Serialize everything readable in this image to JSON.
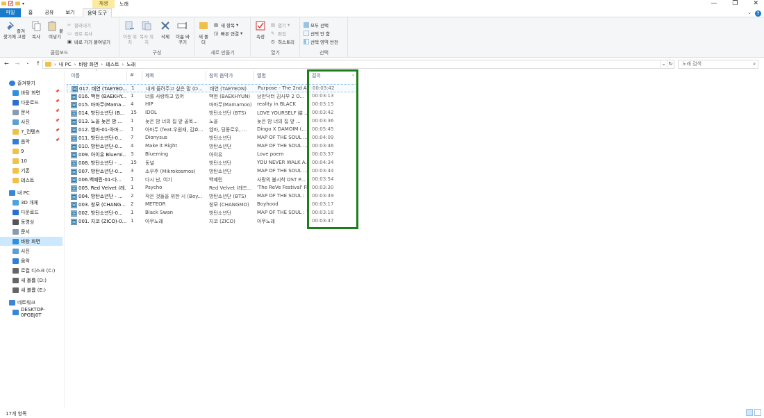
{
  "window": {
    "title": "노래",
    "context_tab_group": "재생",
    "controls": [
      "—",
      "❐",
      "✕"
    ]
  },
  "ribbon_tabs": [
    "파일",
    "홈",
    "공유",
    "보기",
    "음악 도구"
  ],
  "ribbon": {
    "clipboard": {
      "label": "클립보드",
      "pin": "즐겨찾기에 고정",
      "copy": "복사",
      "paste": "붙여넣기",
      "cut": "잘라내기",
      "copy_path": "경로 복사",
      "paste_shortcut": "바로 가기 붙여넣기"
    },
    "organize": {
      "label": "구성",
      "move_to": "이동 위치",
      "copy_to": "복사 위치",
      "delete": "삭제",
      "rename": "이름 바꾸기"
    },
    "new": {
      "label": "새로 만들기",
      "new_folder": "새 폴더",
      "new_item": "새 항목",
      "easy_access": "빠른 연결"
    },
    "open": {
      "label": "열기",
      "properties": "속성",
      "open": "열기",
      "edit": "편집",
      "history": "히스토리"
    },
    "select": {
      "label": "선택",
      "select_all": "모두 선택",
      "select_none": "선택 안 함",
      "invert": "선택 영역 반전"
    }
  },
  "address": {
    "crumbs": [
      "내 PC",
      "바탕 화면",
      "테스트",
      "노래"
    ],
    "search_placeholder": "노래 검색"
  },
  "nav_pane": [
    {
      "label": "즐겨찾기",
      "icon": "star-icon",
      "indent": 0
    },
    {
      "label": "바탕 화면",
      "icon": "desktop-icon",
      "indent": 1,
      "pinned": true
    },
    {
      "label": "다운로드",
      "icon": "download-icon",
      "indent": 1,
      "pinned": true
    },
    {
      "label": "문서",
      "icon": "document-icon",
      "indent": 1,
      "pinned": true
    },
    {
      "label": "사진",
      "icon": "picture-icon",
      "indent": 1,
      "pinned": true
    },
    {
      "label": "7_컨텐츠",
      "icon": "folder-icon",
      "indent": 1,
      "pinned": true
    },
    {
      "label": "음악",
      "icon": "music-icon",
      "indent": 1,
      "pinned": true
    },
    {
      "label": "9",
      "icon": "folder-icon",
      "indent": 1
    },
    {
      "label": "10",
      "icon": "folder-icon",
      "indent": 1
    },
    {
      "label": "기존",
      "icon": "folder-icon",
      "indent": 1
    },
    {
      "label": "테스트",
      "icon": "folder-icon",
      "indent": 1
    },
    {
      "label": "내 PC",
      "icon": "pc-icon",
      "indent": 0
    },
    {
      "label": "3D 개체",
      "icon": "cube-icon",
      "indent": 1
    },
    {
      "label": "다운로드",
      "icon": "download-icon",
      "indent": 1
    },
    {
      "label": "동영상",
      "icon": "video-icon",
      "indent": 1
    },
    {
      "label": "문서",
      "icon": "document-icon",
      "indent": 1
    },
    {
      "label": "바탕 화면",
      "icon": "desktop-icon",
      "indent": 1,
      "selected": true
    },
    {
      "label": "사진",
      "icon": "picture-icon",
      "indent": 1
    },
    {
      "label": "음악",
      "icon": "music-icon",
      "indent": 1
    },
    {
      "label": "로컬 디스크 (C:)",
      "icon": "drive-icon",
      "indent": 1
    },
    {
      "label": "새 볼륨 (D:)",
      "icon": "drive-icon",
      "indent": 1
    },
    {
      "label": "새 볼륨 (E:)",
      "icon": "drive-icon",
      "indent": 1
    },
    {
      "label": "네트워크",
      "icon": "network-icon",
      "indent": 0
    },
    {
      "label": "DESKTOP-0PGBJ0T",
      "icon": "computer-icon",
      "indent": 1
    }
  ],
  "columns": [
    "이름",
    "#",
    "제목",
    "참여 음악가",
    "앨범",
    "길이"
  ],
  "files": [
    {
      "name": "017. 태연 (TAEYEO...",
      "num": "1",
      "title": "내게 들려주고 싶은 말 (D...",
      "artist": "태연 (TAEYEON)",
      "album": "Purpose - The 2nd A...",
      "length": "00:03:42"
    },
    {
      "name": "016. 백현 (BAEKHY...",
      "num": "1",
      "title": "너를 사랑하고 있어",
      "artist": "백현 (BAEKHYUN)",
      "album": "낭만닥터 김사부 2 O...",
      "length": "00:03:13"
    },
    {
      "name": "015. 마마무(Mama...",
      "num": "4",
      "title": "HIP",
      "artist": "마마무(Mamamoo)",
      "album": "reality in BLACK",
      "length": "00:03:15"
    },
    {
      "name": "014. 방탄소년단 (B...",
      "num": "15",
      "title": "IDOL",
      "artist": "방탄소년단 (BTS)",
      "album": "LOVE YOURSELF 結 ...",
      "length": "00:03:42"
    },
    {
      "name": "013. 노을 늦은 밤 ...",
      "num": "1",
      "title": "늦은 밤 너의 집 앞 골목...",
      "artist": "노을",
      "album": "늦은 밤 너의 집 앞 ...",
      "length": "00:03:36"
    },
    {
      "name": "012. 엠마-01-아마...",
      "num": "1",
      "title": "아마두 (feat.우원재, 김효...",
      "artist": "엠마, 딩동로우, ...",
      "album": "Dingo X DAMOIM (...",
      "length": "00:05:45"
    },
    {
      "name": "011. 방탄소년단-0...",
      "num": "7",
      "title": "Dionysus",
      "artist": "방탄소년단",
      "album": "MAP OF THE SOUL ...",
      "length": "00:04:09"
    },
    {
      "name": "010. 방탄소년단-0...",
      "num": "4",
      "title": "Make It Right",
      "artist": "방탄소년단",
      "album": "MAP OF THE SOUL ...",
      "length": "00:03:46"
    },
    {
      "name": "009. 아이유 Bluemi...",
      "num": "3",
      "title": "Blueming",
      "artist": "아이유",
      "album": "Love poem",
      "length": "00:03:37"
    },
    {
      "name": "008. 방탄소년단 - ...",
      "num": "15",
      "title": "동널",
      "artist": "방탄소년단",
      "album": "YOU NEVER WALK A...",
      "length": "00:04:34"
    },
    {
      "name": "007. 방탄소년단-0...",
      "num": "3",
      "title": "소우주 (Mikrokosmos)",
      "artist": "방탄소년단",
      "album": "MAP OF THE SOUL ...",
      "length": "00:03:44"
    },
    {
      "name": "006.백예린-01-다...",
      "num": "1",
      "title": "다시 난, 여기",
      "artist": "백예린",
      "album": "사랑의 불시착 OST P...",
      "length": "00:03:54"
    },
    {
      "name": "005. Red Velvet (레...",
      "num": "1",
      "title": "Psycho",
      "artist": "Red Velvet (레드...",
      "album": "'The ReVe Festival' Fi...",
      "length": "00:03:30"
    },
    {
      "name": "004. 방탄소년단 - ...",
      "num": "2",
      "title": "작은 것들을 위한 시 (Boy...",
      "artist": "방탄소년단 (BTS)",
      "album": "MAP OF THE SOUL : ...",
      "length": "00:03:49"
    },
    {
      "name": "003. 창모 (CHANG...",
      "num": "2",
      "title": "METEOR",
      "artist": "창모 (CHANGMO)",
      "album": "Boyhood",
      "length": "00:03:17"
    },
    {
      "name": "002. 방탄소년단-0...",
      "num": "1",
      "title": "Black Swan",
      "artist": "방탄소년단",
      "album": "MAP OF THE SOUL : 7",
      "length": "00:03:18"
    },
    {
      "name": "001. 지코 (ZICO)-0...",
      "num": "1",
      "title": "아무노래",
      "artist": "지코 (ZICO)",
      "album": "아무노래",
      "length": "00:03:47"
    }
  ],
  "status": {
    "count": "17개 항목"
  },
  "colors": {
    "accent": "#1979ca",
    "highlight": "#1a7f1a",
    "selection": "#cce8ff"
  }
}
